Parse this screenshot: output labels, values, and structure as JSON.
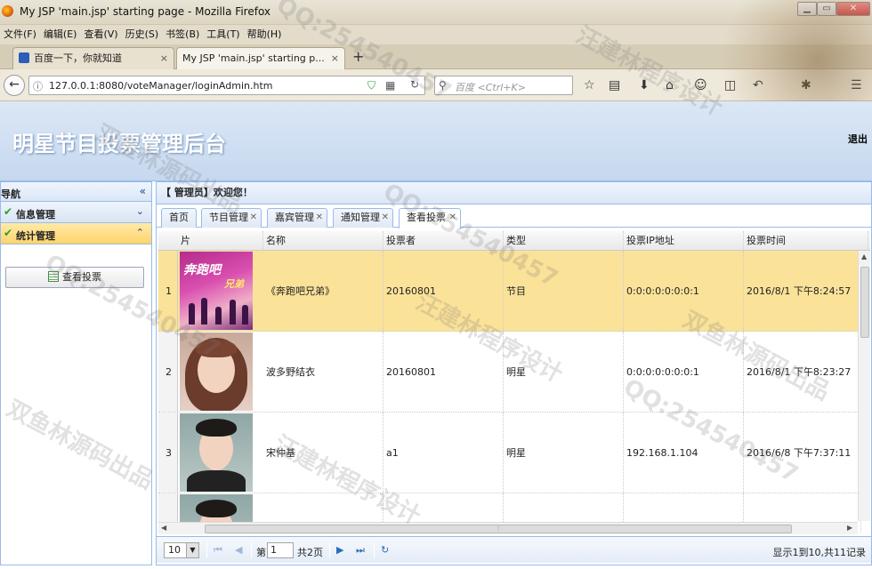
{
  "browser": {
    "window_title": "My JSP 'main.jsp' starting page - Mozilla Firefox",
    "menu": [
      "文件(F)",
      "编辑(E)",
      "查看(V)",
      "历史(S)",
      "书签(B)",
      "工具(T)",
      "帮助(H)"
    ],
    "tabs": [
      {
        "label": "百度一下，你就知道",
        "close": "×"
      },
      {
        "label": "My JSP 'main.jsp' starting p...",
        "close": "×"
      }
    ],
    "new_tab": "+",
    "url": "127.0.0.1:8080/voteManager/loginAdmin.htm",
    "search_placeholder": "百度 <Ctrl+K>"
  },
  "header": {
    "title": "明星节目投票管理后台",
    "logout": "退出"
  },
  "sidebar": {
    "title": "导航",
    "collapse": "«",
    "sections": [
      {
        "label": "信息管理",
        "toggle": "⌄"
      },
      {
        "label": "统计管理",
        "toggle": "⌃"
      }
    ],
    "button": "查看投票"
  },
  "main": {
    "welcome": "【 管理员】欢迎您！",
    "tabs": [
      "首页",
      "节目管理",
      "嘉宾管理",
      "通知管理",
      "查看投票"
    ],
    "columns": [
      "片",
      "名称",
      "投票者",
      "类型",
      "投票IP地址",
      "投票时间"
    ],
    "rows": [
      {
        "num": "1",
        "photo": "ph-show",
        "name": "《奔跑吧兄弟》",
        "voter": "20160801",
        "type": "节目",
        "ip": "0:0:0:0:0:0:0:1",
        "time": "2016/8/1 下午8:24:57",
        "selected": true
      },
      {
        "num": "2",
        "photo": "ph-woman",
        "name": "波多野结衣",
        "voter": "20160801",
        "type": "明星",
        "ip": "0:0:0:0:0:0:0:1",
        "time": "2016/8/1 下午8:23:27",
        "selected": false
      },
      {
        "num": "3",
        "photo": "ph-man",
        "name": "宋仲基",
        "voter": "a1",
        "type": "明星",
        "ip": "192.168.1.104",
        "time": "2016/6/8 下午7:37:11",
        "selected": false
      },
      {
        "num": "4",
        "photo": "ph-man",
        "name": "",
        "voter": "",
        "type": "",
        "ip": "",
        "time": "",
        "selected": false
      }
    ],
    "photo_text": {
      "show_t1": "奔跑吧",
      "show_t2": "兄弟"
    }
  },
  "pager": {
    "page_size": "10",
    "page_label": "第",
    "page_value": "1",
    "total_pages": "共2页",
    "info": "显示1到10,共11记录"
  },
  "watermarks": [
    "QQ:254540457",
    "汪建林程序设计",
    "双鱼林源码出品",
    "QQ:254540457",
    "汪建林程序设计",
    "双鱼林源码出品",
    "QQ:254540457",
    "双鱼林源码出品",
    "QQ:254540457",
    "汪建林程序设计"
  ]
}
